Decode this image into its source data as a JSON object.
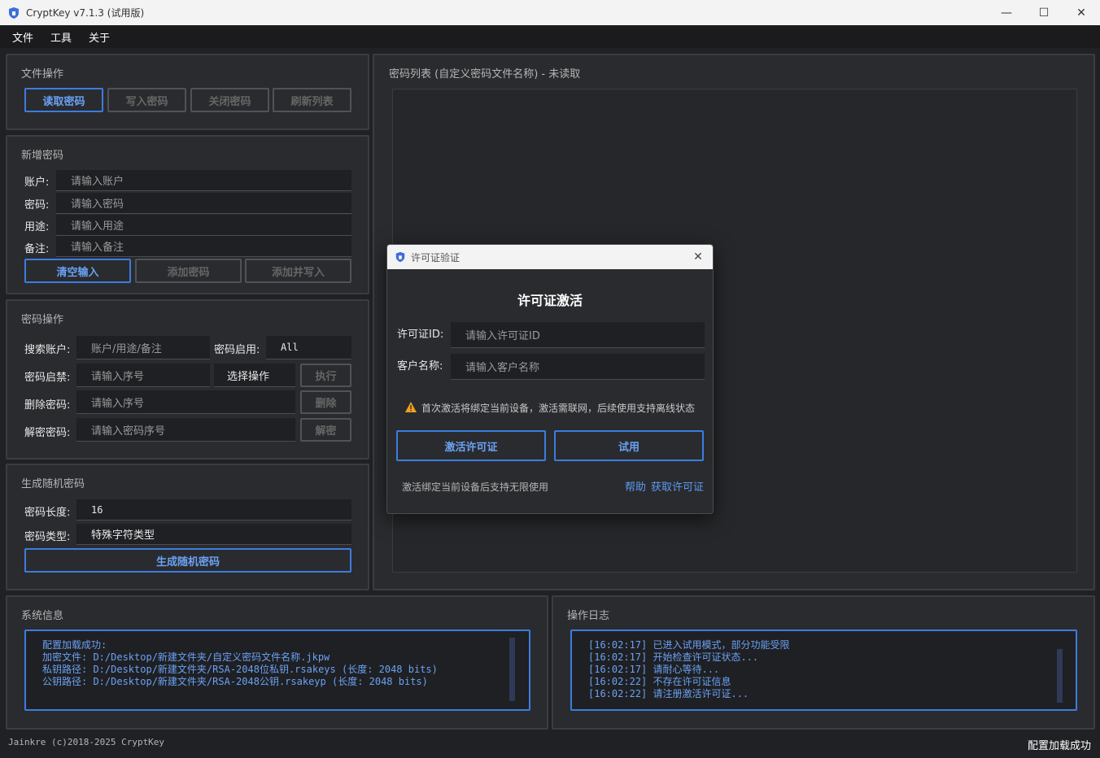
{
  "window": {
    "title": "CryptKey v7.1.3 (试用版)",
    "minimize": "—",
    "maximize": "☐",
    "close": "✕"
  },
  "menu": [
    "文件",
    "工具",
    "关于"
  ],
  "file_ops": {
    "title": "文件操作",
    "read": "读取密码",
    "write": "写入密码",
    "close": "关闭密码",
    "refresh": "刷新列表"
  },
  "new_pw": {
    "title": "新增密码",
    "account_label": "账户:",
    "account_ph": "请输入账户",
    "password_label": "密码:",
    "password_ph": "请输入密码",
    "purpose_label": "用途:",
    "purpose_ph": "请输入用途",
    "note_label": "备注:",
    "note_ph": "请输入备注",
    "clear": "清空输入",
    "add": "添加密码",
    "add_write": "添加并写入"
  },
  "pw_ops": {
    "title": "密码操作",
    "search_label": "搜索账户:",
    "search_ph": "账户/用途/备注",
    "enable_label": "密码启用:",
    "enable_value": "All",
    "toggle_label": "密码启禁:",
    "toggle_ph": "请输入序号",
    "select_op": "选择操作",
    "exec": "执行",
    "delete_label": "删除密码:",
    "delete_ph": "请输入序号",
    "delete": "删除",
    "decrypt_label": "解密密码:",
    "decrypt_ph": "请输入密码序号",
    "decrypt": "解密"
  },
  "random_pw": {
    "title": "生成随机密码",
    "length_label": "密码长度:",
    "length_value": "16",
    "type_label": "密码类型:",
    "type_value": "特殊字符类型",
    "generate": "生成随机密码"
  },
  "list": {
    "title": "密码列表 (自定义密码文件名称) - 未读取"
  },
  "sysinfo": {
    "title": "系统信息",
    "lines": [
      "配置加载成功:",
      "加密文件: D:/Desktop/新建文件夹/自定义密码文件名称.jkpw",
      "私钥路径: D:/Desktop/新建文件夹/RSA-2048位私钥.rsakeys (长度: 2048 bits)",
      "公钥路径: D:/Desktop/新建文件夹/RSA-2048公钥.rsakeyp (长度: 2048 bits)"
    ]
  },
  "log": {
    "title": "操作日志",
    "lines": [
      "[16:02:17] 已进入试用模式，部分功能受限",
      "[16:02:17] 开始检查许可证状态...",
      "[16:02:17] 请耐心等待...",
      "[16:02:22] 不存在许可证信息",
      "[16:02:22] 请注册激活许可证..."
    ]
  },
  "status": {
    "copyright": "Jainkre (c)2018-2025 CryptKey",
    "message": "配置加载成功"
  },
  "dialog": {
    "title": "许可证验证",
    "heading": "许可证激活",
    "id_label": "许可证ID:",
    "id_ph": "请输入许可证ID",
    "name_label": "客户名称:",
    "name_ph": "请输入客户名称",
    "warning": "首次激活将绑定当前设备，激活需联网，后续使用支持离线状态",
    "activate": "激活许可证",
    "trial": "试用",
    "footer": "激活绑定当前设备后支持无限使用",
    "help": "帮助",
    "get_license": "获取许可证"
  },
  "colors": {
    "accent": "#3c7ce0",
    "link": "#5a9af5",
    "background": "#202124",
    "panel": "#2a2b2e",
    "warning": "#f0a020"
  }
}
